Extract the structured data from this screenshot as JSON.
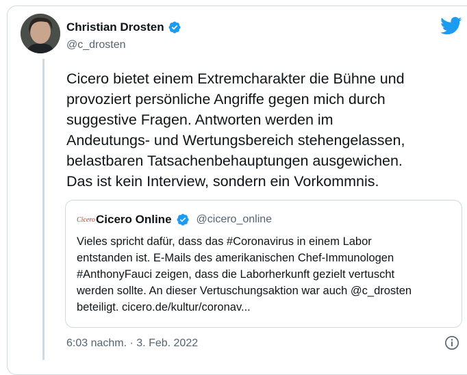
{
  "tweet": {
    "author": {
      "name": "Christian Drosten",
      "handle": "@c_drosten",
      "verified": true
    },
    "text": "Cicero bietet einem Extremcharakter die Bühne und\nprovoziert persönliche Angriffe gegen mich durch\nsuggestive Fragen. Antworten werden im\nAndeutungs- und Wertungsbereich stehengelassen,\nbelastbaren Tatsachenbehauptungen ausgewichen.\nDas ist kein Interview, sondern ein Vorkommnis.",
    "quoted": {
      "logo_text": "Cicero",
      "name": "Cicero Online",
      "handle": "@cicero_online",
      "verified": true,
      "text": "Vieles spricht dafür, dass das #Coronavirus in einem Labor\nentstanden ist. E-Mails des amerikanischen Chef-Immunologen\n#AnthonyFauci zeigen, dass die Laborherkunft gezielt vertuscht\nwerden sollte. An dieser Vertuschungsaktion war auch @c_drosten\nbeteiligt. cicero.de/kultur/coronav..."
    },
    "timestamp": "6:03 nachm. · 3. Feb. 2022"
  },
  "colors": {
    "twitter_blue": "#1d9bf0",
    "secondary_text": "#536471",
    "border": "#cfd9de"
  },
  "icons": {
    "brand": "twitter-bird-icon",
    "verified": "verified-badge-icon",
    "info": "info-icon"
  }
}
